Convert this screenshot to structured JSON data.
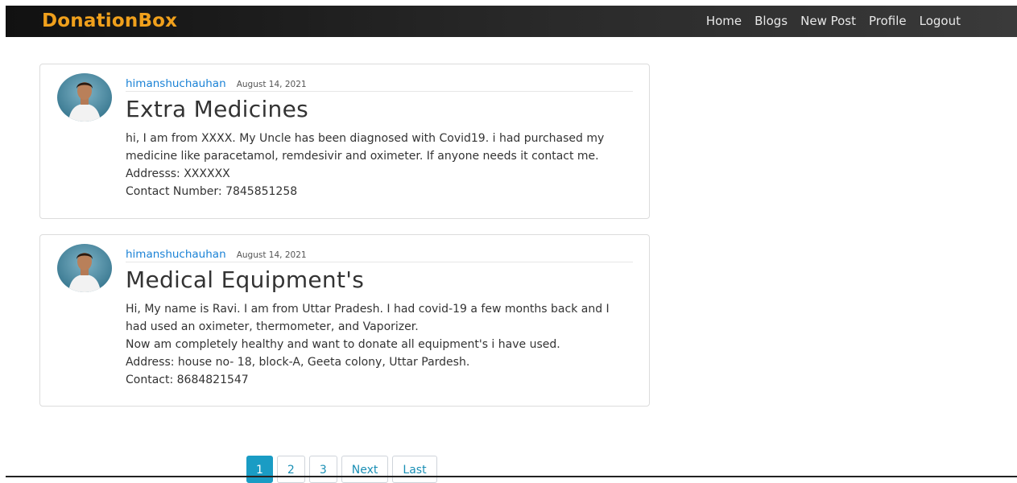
{
  "navbar": {
    "brand": "DonationBox",
    "links": [
      "Home",
      "Blogs",
      "New Post",
      "Profile",
      "Logout"
    ]
  },
  "posts": [
    {
      "author": "himanshuchauhan",
      "date": "August 14, 2021",
      "title": "Extra Medicines",
      "lines": [
        "hi, I am from XXXX. My Uncle has been diagnosed with Covid19. i had purchased my",
        "medicine like paracetamol, remdesivir and oximeter. If anyone needs it contact me.",
        "Addresss: XXXXXX",
        "Contact Number: 7845851258"
      ]
    },
    {
      "author": "himanshuchauhan",
      "date": "August 14, 2021",
      "title": "Medical Equipment's",
      "lines": [
        "Hi, My name is Ravi. I am from Uttar Pradesh. I had covid-19 a few months back and I",
        "had used an oximeter, thermometer, and Vaporizer.",
        "Now am completely healthy and want to donate all equipment's i have used.",
        "Address: house no- 18, block-A, Geeta colony, Uttar Pardesh.",
        "Contact: 8684821547"
      ]
    }
  ],
  "pagination": {
    "pages": [
      "1",
      "2",
      "3"
    ],
    "next_label": "Next",
    "last_label": "Last",
    "active_page": "1"
  }
}
